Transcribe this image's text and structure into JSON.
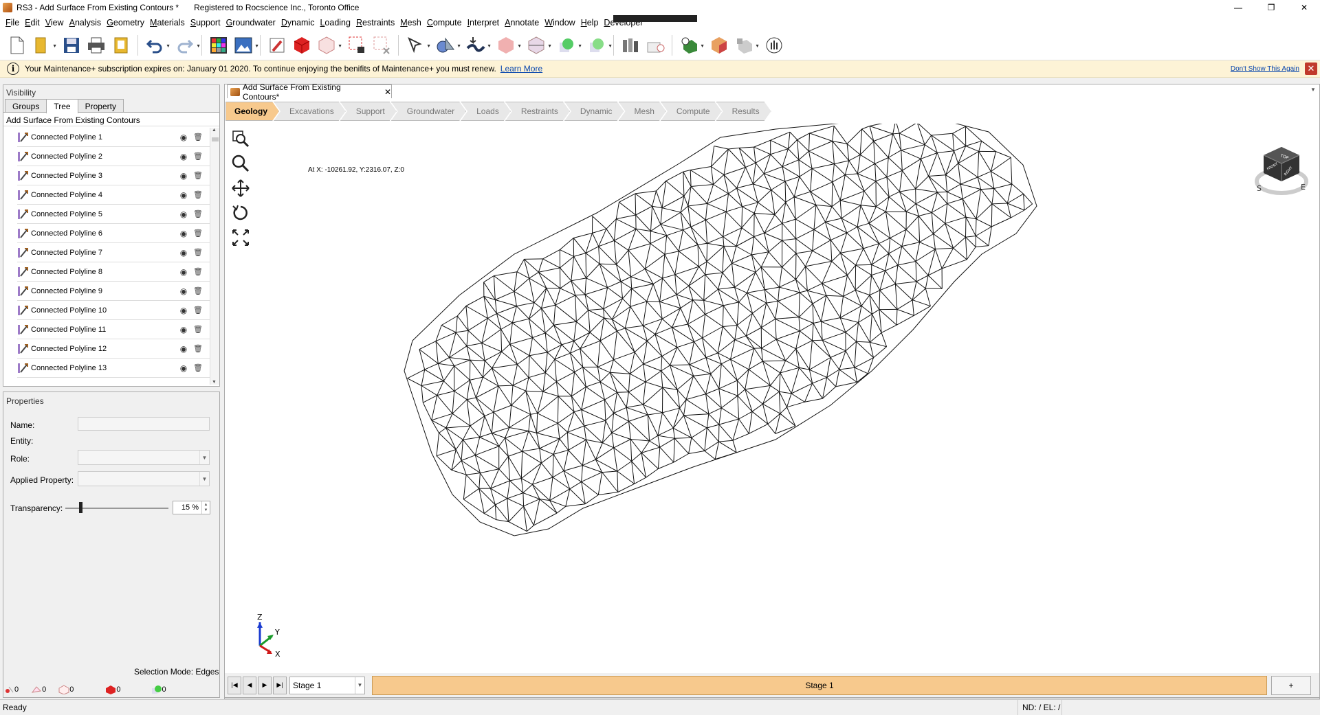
{
  "window": {
    "title": "RS3 - Add Surface From Existing Contours *",
    "registered": "Registered to Rocscience Inc., Toronto Office",
    "minimize": "—",
    "maximize": "❐",
    "close": "✕"
  },
  "menu": [
    "File",
    "Edit",
    "View",
    "Analysis",
    "Geometry",
    "Materials",
    "Support",
    "Groundwater",
    "Dynamic",
    "Loading",
    "Restraints",
    "Mesh",
    "Compute",
    "Interpret",
    "Annotate",
    "Window",
    "Help",
    "Developer"
  ],
  "notice": {
    "message": "Your Maintenance+ subscription expires on: January 01 2020. To continue enjoying the benifits of Maintenance+ you must renew.",
    "link": "Learn More",
    "dont_show": "Don't Show This Again"
  },
  "visibility": {
    "header": "Visibility",
    "tabs": [
      "Groups",
      "Tree",
      "Property"
    ],
    "active_tab": "Tree",
    "tree_title": "Add Surface From Existing Contours",
    "items": [
      "Connected Polyline 1",
      "Connected Polyline 2",
      "Connected Polyline 3",
      "Connected Polyline 4",
      "Connected Polyline 5",
      "Connected Polyline 6",
      "Connected Polyline 7",
      "Connected Polyline 8",
      "Connected Polyline 9",
      "Connected Polyline 10",
      "Connected Polyline 11",
      "Connected Polyline 12",
      "Connected Polyline 13"
    ]
  },
  "properties": {
    "header": "Properties",
    "name_label": "Name:",
    "entity_label": "Entity:",
    "role_label": "Role:",
    "applied_label": "Applied Property:",
    "transparency_label": "Transparency:",
    "transparency_value": "15 %",
    "transparency_fraction": 0.15,
    "selection_mode": "Selection Mode: Edges",
    "counts": [
      "0",
      "0",
      "0",
      "0",
      "0"
    ]
  },
  "document": {
    "tab_title": "Add Surface From Existing Contours*",
    "tab_close": "✕",
    "workflow": [
      "Geology",
      "Excavations",
      "Support",
      "Groundwater",
      "Loads",
      "Restraints",
      "Dynamic",
      "Mesh",
      "Compute",
      "Results"
    ],
    "active_step": "Geology",
    "coordinates": "At X: -10261.92, Y:2316.07, Z:0",
    "axes": {
      "z": "Z",
      "y": "Y",
      "x": "X"
    },
    "navcube": {
      "top": "TOP",
      "front": "FRONT",
      "right": "RIGHT",
      "s": "S",
      "e": "E"
    }
  },
  "stage": {
    "combo_value": "Stage 1",
    "label": "Stage 1",
    "plus": "+"
  },
  "status": {
    "ready": "Ready",
    "nd_el": "ND: /  EL: /"
  },
  "colors": {
    "accent_orange": "#f7c98d",
    "notice_bg": "#fdf3d6",
    "link_blue": "#0645ad"
  }
}
